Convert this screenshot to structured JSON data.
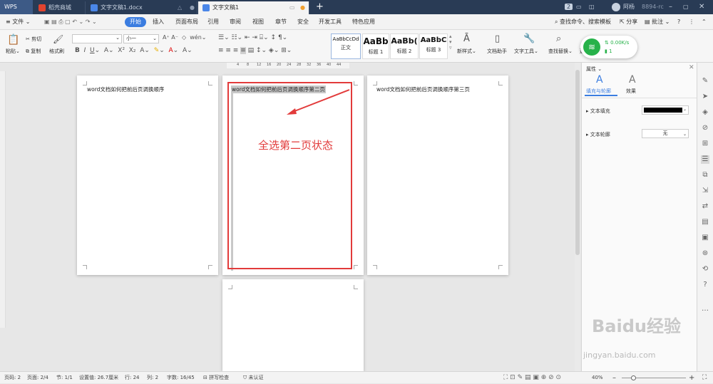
{
  "app": {
    "name": "WPS"
  },
  "tabs": [
    {
      "label": "稻壳商城",
      "icon": "daoke-icon"
    },
    {
      "label": "文字文稿1.docx",
      "icon": "doc-icon"
    },
    {
      "label": "文字文稿1",
      "icon": "doc-icon"
    }
  ],
  "titlebar": {
    "badge": "2",
    "user": "阿杨",
    "extra": "8894-rc"
  },
  "menu": {
    "file": "文件",
    "items": [
      "开始",
      "插入",
      "页面布局",
      "引用",
      "审阅",
      "视图",
      "章节",
      "安全",
      "开发工具",
      "特色应用"
    ],
    "search": "查找命令、搜索模板",
    "share": "分享",
    "comment": "批注"
  },
  "ribbon": {
    "paste": "粘贴",
    "cut": "剪切",
    "copy": "复制",
    "format_painter": "格式刷",
    "font_size": "小一",
    "styles": [
      {
        "sample": "AaBbCcDd",
        "name": "正文"
      },
      {
        "sample": "AaBb",
        "name": "标题 1"
      },
      {
        "sample": "AaBb(",
        "name": "标题 2"
      },
      {
        "sample": "AaBbC",
        "name": "标题 3"
      }
    ],
    "new_style": "新样式",
    "doc_helper": "文档助手",
    "doc_tools": "文字工具",
    "find_replace": "查找替换",
    "select": "选"
  },
  "network": {
    "speed": "0.00K/s",
    "count": "1"
  },
  "ruler": [
    "4",
    "8",
    "12",
    "16",
    "20",
    "24",
    "28",
    "32",
    "36",
    "40",
    "44"
  ],
  "pages": {
    "p1": "word文档如何把前后页调换顺序",
    "p2": "word文档如何把前后页调换顺序第二页",
    "p3": "word文档如何把前后页调换顺序第三页",
    "annotation": "全选第二页状态"
  },
  "panel": {
    "title": "属性",
    "tab_fill": "填充与轮廓",
    "tab_effect": "效果",
    "text_fill": "文本填充",
    "text_outline": "文本轮廓",
    "outline_value": "无",
    "fill_color": "#000000"
  },
  "status": {
    "page_num": "页码: 2",
    "pages": "页面: 2/4",
    "section": "节: 1/1",
    "setting": "设置值: 26.7厘米",
    "row": "行: 24",
    "col": "列: 2",
    "words": "字数: 16/45",
    "spell": "拼写检查",
    "cert": "未认证",
    "zoom": "40%"
  },
  "watermark": {
    "brand": "Baidu经验",
    "url": "jingyan.baidu.com"
  }
}
